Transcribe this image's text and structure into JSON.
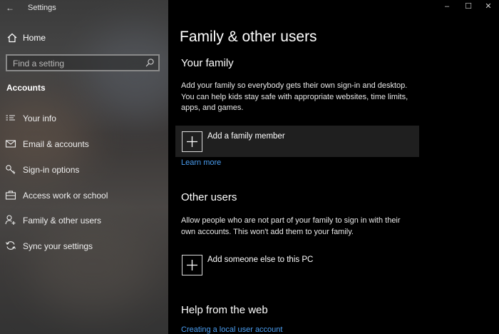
{
  "window": {
    "app_title": "Settings",
    "controls": {
      "minimize": "–",
      "maximize": "☐",
      "close": "✕"
    },
    "back_glyph": "←"
  },
  "sidebar": {
    "home_label": "Home",
    "search_placeholder": "Find a setting",
    "section_title": "Accounts",
    "items": [
      {
        "label": "Your info",
        "icon": "your-info-icon"
      },
      {
        "label": "Email & accounts",
        "icon": "email-icon"
      },
      {
        "label": "Sign-in options",
        "icon": "key-icon"
      },
      {
        "label": "Access work or school",
        "icon": "briefcase-icon"
      },
      {
        "label": "Family & other users",
        "icon": "add-person-icon"
      },
      {
        "label": "Sync your settings",
        "icon": "sync-icon"
      }
    ]
  },
  "main": {
    "title": "Family & other users",
    "your_family": {
      "heading": "Your family",
      "description_lines": [
        "Add your family so everybody gets their own sign-in and desktop.",
        "You can help kids stay safe with appropriate websites, time limits,",
        "apps, and games."
      ],
      "add_label": "Add a family member",
      "learn_more": "Learn more"
    },
    "other_users": {
      "heading": "Other users",
      "description_lines": [
        "Allow people who are not part of your family to sign in with their",
        "own accounts. This won't add them to your family."
      ],
      "add_label": "Add someone else to this PC"
    },
    "help": {
      "heading": "Help from the web",
      "link": "Creating a local user account"
    }
  },
  "colors": {
    "accent_link": "#4a9df0",
    "background": "#000000",
    "highlight_row": "#1f1f1f"
  }
}
